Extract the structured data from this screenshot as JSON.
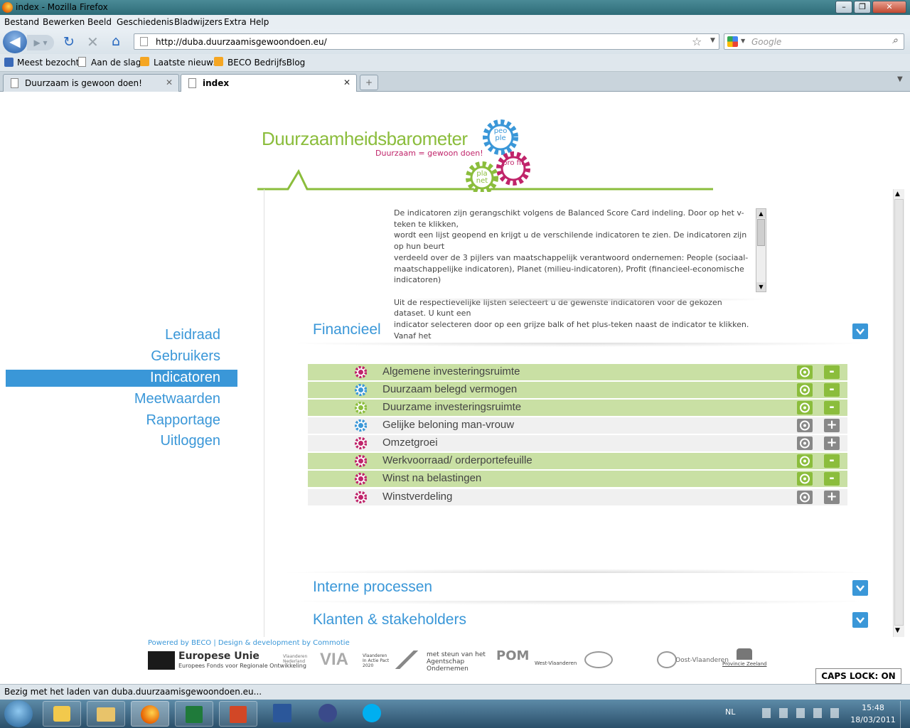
{
  "window": {
    "title": "index - Mozilla Firefox"
  },
  "menu": [
    "Bestand",
    "Bewerken",
    "Beeld",
    "Geschiedenis",
    "Bladwijzers",
    "Extra",
    "Help"
  ],
  "url": "http://duba.duurzaamisgewoondoen.eu/",
  "search": {
    "placeholder": "Google"
  },
  "bookmarks": [
    "Meest bezocht",
    "Aan de slag",
    "Laatste nieuws",
    "BECO BedrijfsBlog"
  ],
  "tabs": [
    {
      "label": "Duurzaam is gewoon doen!",
      "active": false
    },
    {
      "label": "index",
      "active": true
    }
  ],
  "logo": {
    "title": "Duurzaamheidsbarometer",
    "subtitle": "Duurzaam = gewoon doen!",
    "gear_people": "peo ple",
    "gear_profit": "pro fit",
    "gear_planet": "pla net"
  },
  "nav": [
    "Leidraad",
    "Gebruikers",
    "Indicatoren",
    "Meetwaarden",
    "Rapportage",
    "Uitloggen"
  ],
  "nav_active": "Indicatoren",
  "info": {
    "p1_l1": "De indicatoren zijn gerangschikt volgens de Balanced Score Card indeling. Door op het v-teken te klikken,",
    "p1_l2": "wordt een lijst geopend en krijgt u de verschilende indicatoren te zien. De indicatoren zijn op hun beurt",
    "p1_l3": "verdeeld over de 3 pijlers van maatschappelijk verantwoord ondernemen: People (sociaal-",
    "p1_l4": "maatschappelijke indicatoren), Planet (milieu-indicatoren), Profit (financieel-economische indicatoren)",
    "p2_l1": "Uit de respectievelijke lijsten selecteert u de gewenste indicatoren voor de gekozen dataset. U kunt een",
    "p2_l2": "indicator selecteren door op een grijze balk of het plus-teken naast de indicator te klikken. Vanaf het"
  },
  "sections": [
    "Financieel",
    "Interne processen",
    "Klanten & stakeholders"
  ],
  "indicators": [
    {
      "name": "Algemene investeringsruimte",
      "pillar": "profit",
      "selected": true
    },
    {
      "name": "Duurzaam belegd vermogen",
      "pillar": "people",
      "selected": true
    },
    {
      "name": "Duurzame investeringsruimte",
      "pillar": "planet",
      "selected": true
    },
    {
      "name": "Gelijke beloning man-vrouw",
      "pillar": "people",
      "selected": false
    },
    {
      "name": "Omzetgroei",
      "pillar": "profit",
      "selected": false
    },
    {
      "name": "Werkvoorraad/ orderportefeuille",
      "pillar": "profit",
      "selected": true
    },
    {
      "name": "Winst na belastingen",
      "pillar": "profit",
      "selected": true
    },
    {
      "name": "Winstverdeling",
      "pillar": "profit",
      "selected": false
    }
  ],
  "colors": {
    "accent": "#3a97d8",
    "green": "#8bbd3c",
    "selected_row": "#c9e0a4",
    "unselected_row": "#f0f0f0",
    "profit": "#c0246a",
    "people": "#3a97d8",
    "planet": "#8bbd3c"
  },
  "footer": {
    "credit": "Powered by BECO | Design & development by Commotie",
    "eu_title": "Europese Unie",
    "eu_sub": "Europees Fonds voor Regionale Ontwikkeling",
    "vl_ned": "Vlaanderen Nederland",
    "via": "VIA",
    "via_sub": "Vlaanderen In Actie Pact 2020",
    "steun": "met steun van het Agentschap Ondernemen",
    "pom": "POM",
    "wvl": "West-Vlaanderen",
    "ovl": "Oost-Vlaanderen",
    "zeeland": "Provincie Zeeland"
  },
  "status": {
    "text": "Bezig met het laden van duba.duurzaamisgewoondoen.eu...",
    "caps": "CAPS LOCK: ON"
  },
  "tray": {
    "lang": "NL",
    "time": "15:48",
    "date": "18/03/2011"
  }
}
